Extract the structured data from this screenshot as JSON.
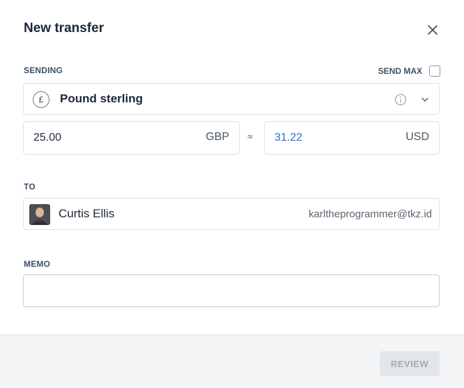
{
  "modal": {
    "title": "New transfer",
    "close_icon": "close-icon"
  },
  "sending": {
    "label": "SENDING",
    "send_max_label": "SEND MAX",
    "send_max_checked": false,
    "currency_icon": "£",
    "currency_name": "Pound sterling",
    "from_amount": "25.00",
    "from_code": "GBP",
    "approx_symbol": "≈",
    "to_amount": "31.22",
    "to_code": "USD"
  },
  "to": {
    "label": "TO",
    "name": "Curtis Ellis",
    "email": "karltheprogrammer@tkz.id"
  },
  "memo": {
    "label": "MEMO",
    "value": "",
    "placeholder": ""
  },
  "footer": {
    "review_label": "REVIEW",
    "review_disabled": true
  },
  "colors": {
    "converted_amount": "#2f6fd0",
    "label": "#3a5069",
    "footer_bg": "#f4f5f6"
  }
}
